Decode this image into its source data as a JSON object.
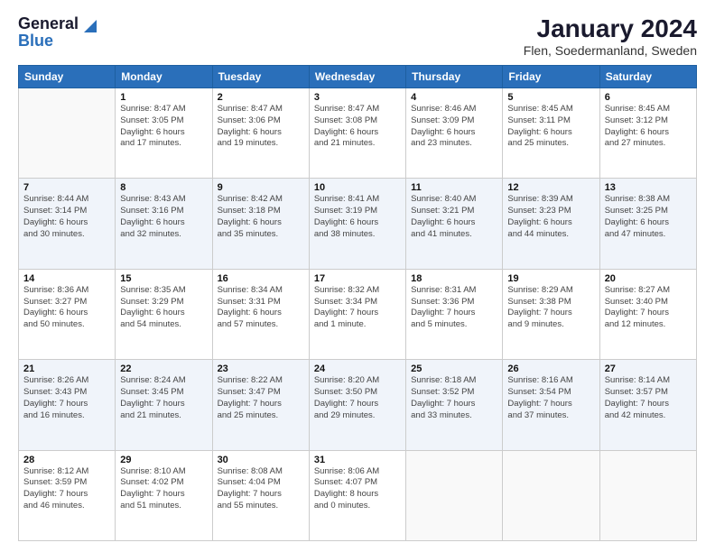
{
  "header": {
    "logo_line1": "General",
    "logo_line2": "Blue",
    "title": "January 2024",
    "subtitle": "Flen, Soedermanland, Sweden"
  },
  "days_of_week": [
    "Sunday",
    "Monday",
    "Tuesday",
    "Wednesday",
    "Thursday",
    "Friday",
    "Saturday"
  ],
  "weeks": [
    {
      "row_class": "row-odd",
      "days": [
        {
          "num": "",
          "info": "",
          "empty": true
        },
        {
          "num": "1",
          "info": "Sunrise: 8:47 AM\nSunset: 3:05 PM\nDaylight: 6 hours\nand 17 minutes.",
          "empty": false
        },
        {
          "num": "2",
          "info": "Sunrise: 8:47 AM\nSunset: 3:06 PM\nDaylight: 6 hours\nand 19 minutes.",
          "empty": false
        },
        {
          "num": "3",
          "info": "Sunrise: 8:47 AM\nSunset: 3:08 PM\nDaylight: 6 hours\nand 21 minutes.",
          "empty": false
        },
        {
          "num": "4",
          "info": "Sunrise: 8:46 AM\nSunset: 3:09 PM\nDaylight: 6 hours\nand 23 minutes.",
          "empty": false
        },
        {
          "num": "5",
          "info": "Sunrise: 8:45 AM\nSunset: 3:11 PM\nDaylight: 6 hours\nand 25 minutes.",
          "empty": false
        },
        {
          "num": "6",
          "info": "Sunrise: 8:45 AM\nSunset: 3:12 PM\nDaylight: 6 hours\nand 27 minutes.",
          "empty": false
        }
      ]
    },
    {
      "row_class": "row-even",
      "days": [
        {
          "num": "7",
          "info": "Sunrise: 8:44 AM\nSunset: 3:14 PM\nDaylight: 6 hours\nand 30 minutes.",
          "empty": false
        },
        {
          "num": "8",
          "info": "Sunrise: 8:43 AM\nSunset: 3:16 PM\nDaylight: 6 hours\nand 32 minutes.",
          "empty": false
        },
        {
          "num": "9",
          "info": "Sunrise: 8:42 AM\nSunset: 3:18 PM\nDaylight: 6 hours\nand 35 minutes.",
          "empty": false
        },
        {
          "num": "10",
          "info": "Sunrise: 8:41 AM\nSunset: 3:19 PM\nDaylight: 6 hours\nand 38 minutes.",
          "empty": false
        },
        {
          "num": "11",
          "info": "Sunrise: 8:40 AM\nSunset: 3:21 PM\nDaylight: 6 hours\nand 41 minutes.",
          "empty": false
        },
        {
          "num": "12",
          "info": "Sunrise: 8:39 AM\nSunset: 3:23 PM\nDaylight: 6 hours\nand 44 minutes.",
          "empty": false
        },
        {
          "num": "13",
          "info": "Sunrise: 8:38 AM\nSunset: 3:25 PM\nDaylight: 6 hours\nand 47 minutes.",
          "empty": false
        }
      ]
    },
    {
      "row_class": "row-odd",
      "days": [
        {
          "num": "14",
          "info": "Sunrise: 8:36 AM\nSunset: 3:27 PM\nDaylight: 6 hours\nand 50 minutes.",
          "empty": false
        },
        {
          "num": "15",
          "info": "Sunrise: 8:35 AM\nSunset: 3:29 PM\nDaylight: 6 hours\nand 54 minutes.",
          "empty": false
        },
        {
          "num": "16",
          "info": "Sunrise: 8:34 AM\nSunset: 3:31 PM\nDaylight: 6 hours\nand 57 minutes.",
          "empty": false
        },
        {
          "num": "17",
          "info": "Sunrise: 8:32 AM\nSunset: 3:34 PM\nDaylight: 7 hours\nand 1 minute.",
          "empty": false
        },
        {
          "num": "18",
          "info": "Sunrise: 8:31 AM\nSunset: 3:36 PM\nDaylight: 7 hours\nand 5 minutes.",
          "empty": false
        },
        {
          "num": "19",
          "info": "Sunrise: 8:29 AM\nSunset: 3:38 PM\nDaylight: 7 hours\nand 9 minutes.",
          "empty": false
        },
        {
          "num": "20",
          "info": "Sunrise: 8:27 AM\nSunset: 3:40 PM\nDaylight: 7 hours\nand 12 minutes.",
          "empty": false
        }
      ]
    },
    {
      "row_class": "row-even",
      "days": [
        {
          "num": "21",
          "info": "Sunrise: 8:26 AM\nSunset: 3:43 PM\nDaylight: 7 hours\nand 16 minutes.",
          "empty": false
        },
        {
          "num": "22",
          "info": "Sunrise: 8:24 AM\nSunset: 3:45 PM\nDaylight: 7 hours\nand 21 minutes.",
          "empty": false
        },
        {
          "num": "23",
          "info": "Sunrise: 8:22 AM\nSunset: 3:47 PM\nDaylight: 7 hours\nand 25 minutes.",
          "empty": false
        },
        {
          "num": "24",
          "info": "Sunrise: 8:20 AM\nSunset: 3:50 PM\nDaylight: 7 hours\nand 29 minutes.",
          "empty": false
        },
        {
          "num": "25",
          "info": "Sunrise: 8:18 AM\nSunset: 3:52 PM\nDaylight: 7 hours\nand 33 minutes.",
          "empty": false
        },
        {
          "num": "26",
          "info": "Sunrise: 8:16 AM\nSunset: 3:54 PM\nDaylight: 7 hours\nand 37 minutes.",
          "empty": false
        },
        {
          "num": "27",
          "info": "Sunrise: 8:14 AM\nSunset: 3:57 PM\nDaylight: 7 hours\nand 42 minutes.",
          "empty": false
        }
      ]
    },
    {
      "row_class": "row-odd",
      "days": [
        {
          "num": "28",
          "info": "Sunrise: 8:12 AM\nSunset: 3:59 PM\nDaylight: 7 hours\nand 46 minutes.",
          "empty": false
        },
        {
          "num": "29",
          "info": "Sunrise: 8:10 AM\nSunset: 4:02 PM\nDaylight: 7 hours\nand 51 minutes.",
          "empty": false
        },
        {
          "num": "30",
          "info": "Sunrise: 8:08 AM\nSunset: 4:04 PM\nDaylight: 7 hours\nand 55 minutes.",
          "empty": false
        },
        {
          "num": "31",
          "info": "Sunrise: 8:06 AM\nSunset: 4:07 PM\nDaylight: 8 hours\nand 0 minutes.",
          "empty": false
        },
        {
          "num": "",
          "info": "",
          "empty": true
        },
        {
          "num": "",
          "info": "",
          "empty": true
        },
        {
          "num": "",
          "info": "",
          "empty": true
        }
      ]
    }
  ]
}
